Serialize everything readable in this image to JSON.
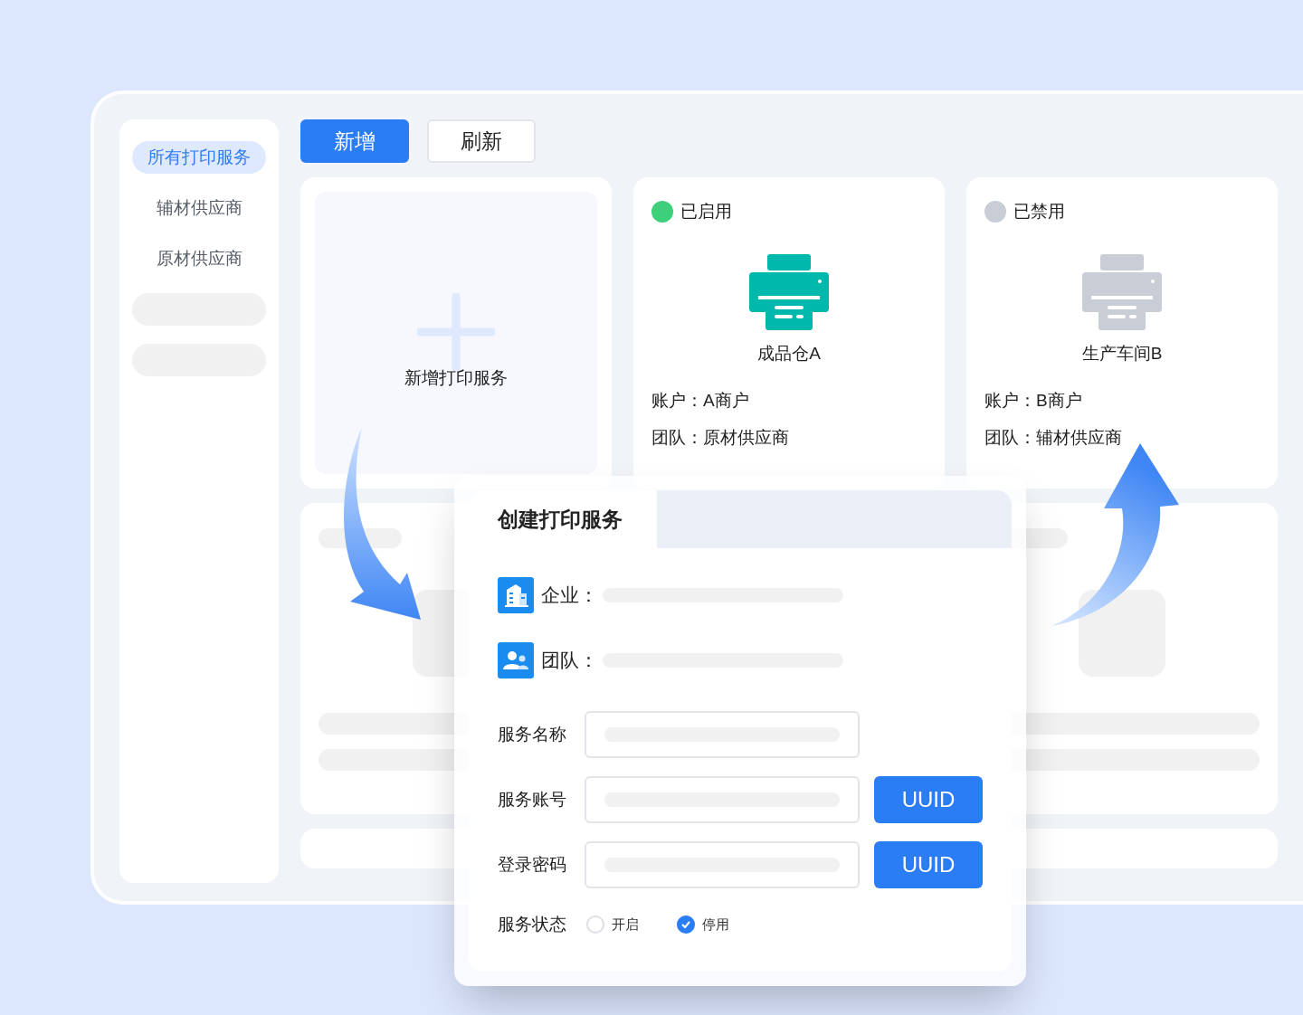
{
  "toolbar": {
    "buttons": [
      {
        "label": "新增",
        "kind": "primary"
      },
      {
        "label": "刷新",
        "kind": "default"
      }
    ]
  },
  "sidebar": {
    "items": [
      {
        "label": "所有打印服务",
        "selected": true
      },
      {
        "label": "辅材供应商",
        "selected": false
      },
      {
        "label": "原材供应商",
        "selected": false
      }
    ]
  },
  "add_card": {
    "label": "新增打印服务"
  },
  "services": [
    {
      "status": "已启用",
      "enabled": true,
      "name": "成品仓A",
      "account": "账户：A商户",
      "team": "团队：原材供应商"
    },
    {
      "status": "已禁用",
      "enabled": false,
      "name": "生产车间B",
      "account": "账户：B商户",
      "team": "团队：辅材供应商"
    }
  ],
  "dialog": {
    "title": "创建打印服务",
    "info_rows": [
      {
        "label": "企业：",
        "kind": "company"
      },
      {
        "label": "团队：",
        "kind": "team"
      }
    ],
    "fields": [
      {
        "label": "服务名称"
      },
      {
        "label": "服务账号",
        "button": "UUID"
      },
      {
        "label": "登录密码",
        "button": "UUID"
      }
    ],
    "status": {
      "label": "服务状态",
      "options": [
        {
          "label": "开启",
          "selected": false
        },
        {
          "label": "停用",
          "selected": true
        }
      ]
    }
  }
}
